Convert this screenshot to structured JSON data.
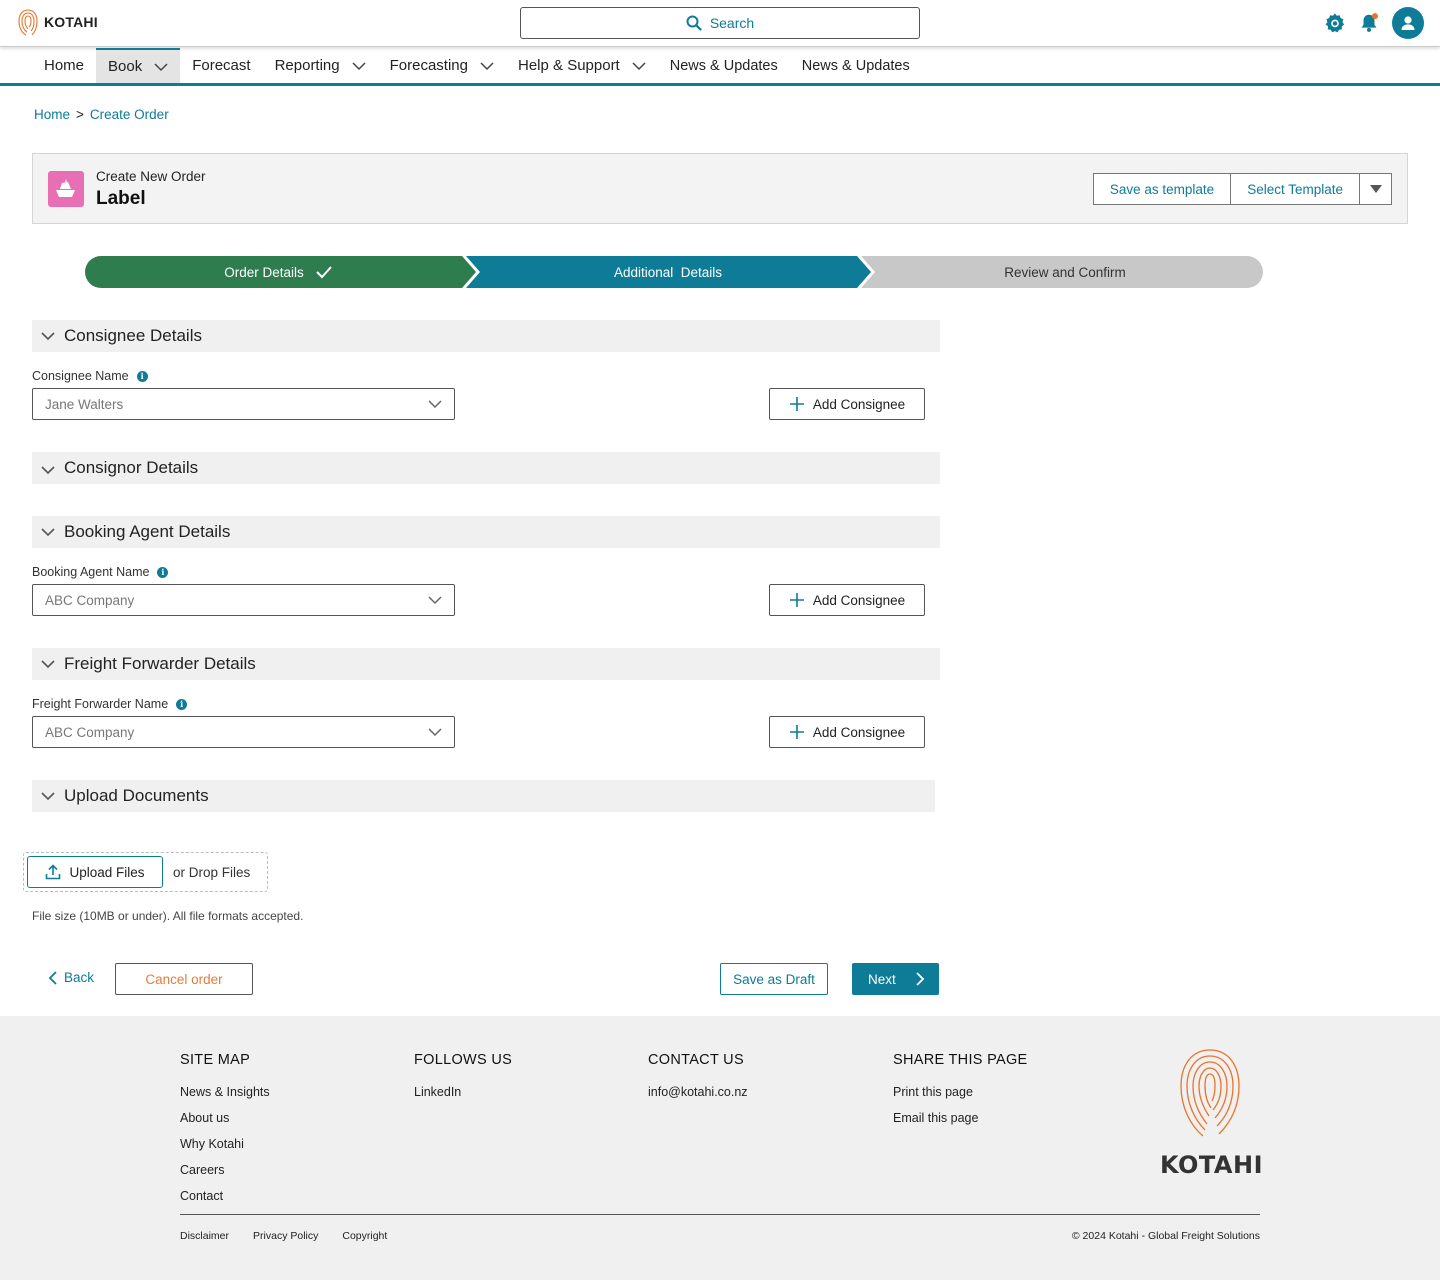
{
  "header": {
    "logo_text": "KOTAHI",
    "search_placeholder": "Search"
  },
  "nav": {
    "items": [
      {
        "label": "Home",
        "has_dropdown": false,
        "active": false
      },
      {
        "label": "Book",
        "has_dropdown": true,
        "active": true
      },
      {
        "label": "Forecast",
        "has_dropdown": false,
        "active": false
      },
      {
        "label": "Reporting",
        "has_dropdown": true,
        "active": false
      },
      {
        "label": "Forecasting",
        "has_dropdown": true,
        "active": false
      },
      {
        "label": "Help & Support",
        "has_dropdown": true,
        "active": false
      },
      {
        "label": "News & Updates",
        "has_dropdown": false,
        "active": false
      },
      {
        "label": "News & Updates",
        "has_dropdown": false,
        "active": false
      }
    ]
  },
  "breadcrumb": {
    "home": "Home",
    "separator": ">",
    "current": "Create Order"
  },
  "order": {
    "subtitle": "Create New Order",
    "title": "Label",
    "save_template": "Save as template",
    "select_template": "Select Template"
  },
  "stepper": {
    "steps": [
      {
        "label": "Order Details",
        "state": "complete",
        "color": "#2e7d4f"
      },
      {
        "label": "Additional  Details",
        "state": "current",
        "color": "#0e7c97"
      },
      {
        "label": "Review and Confirm",
        "state": "upcoming",
        "color": "#c8c8c8"
      }
    ]
  },
  "sections": {
    "consignee": {
      "title": "Consignee Details",
      "label": "Consignee Name",
      "value": "Jane Walters",
      "add_label": "Add Consignee"
    },
    "consignor": {
      "title": "Consignor Details"
    },
    "booking_agent": {
      "title": "Booking Agent Details",
      "label": "Booking Agent Name",
      "value": "ABC Company",
      "add_label": "Add Consignee"
    },
    "freight_forwarder": {
      "title": "Freight Forwarder Details",
      "label": "Freight Forwarder Name",
      "value": "ABC Company",
      "add_label": "Add Consignee"
    },
    "upload": {
      "title": "Upload Documents",
      "button": "Upload Files",
      "or_drop": "or Drop Files",
      "hint": "File size (10MB or under). All file formats accepted."
    }
  },
  "actions": {
    "back": "Back",
    "cancel": "Cancel order",
    "draft": "Save as Draft",
    "next": "Next"
  },
  "footer": {
    "sitemap": {
      "title": "SITE MAP",
      "links": [
        "News & Insights",
        "About us",
        "Why Kotahi",
        "Careers",
        "Contact"
      ]
    },
    "follow": {
      "title": "FOLLOWS US",
      "links": [
        "LinkedIn"
      ]
    },
    "contact": {
      "title": "CONTACT US",
      "links": [
        "info@kotahi.co.nz"
      ]
    },
    "share": {
      "title": "SHARE THIS PAGE",
      "links": [
        "Print this page",
        "Email this page"
      ]
    },
    "logo_text": "KOTAHI",
    "legal": [
      "Disclaimer",
      "Privacy Policy",
      "Copyright"
    ],
    "copyright": "© 2024 Kotahi - Global Freight Solutions"
  },
  "colors": {
    "accent": "#0e7c97",
    "success": "#2e7d4f",
    "cancel": "#e27d3f",
    "order_icon": "#e96fb4",
    "notification_dot": "#e8742c"
  }
}
